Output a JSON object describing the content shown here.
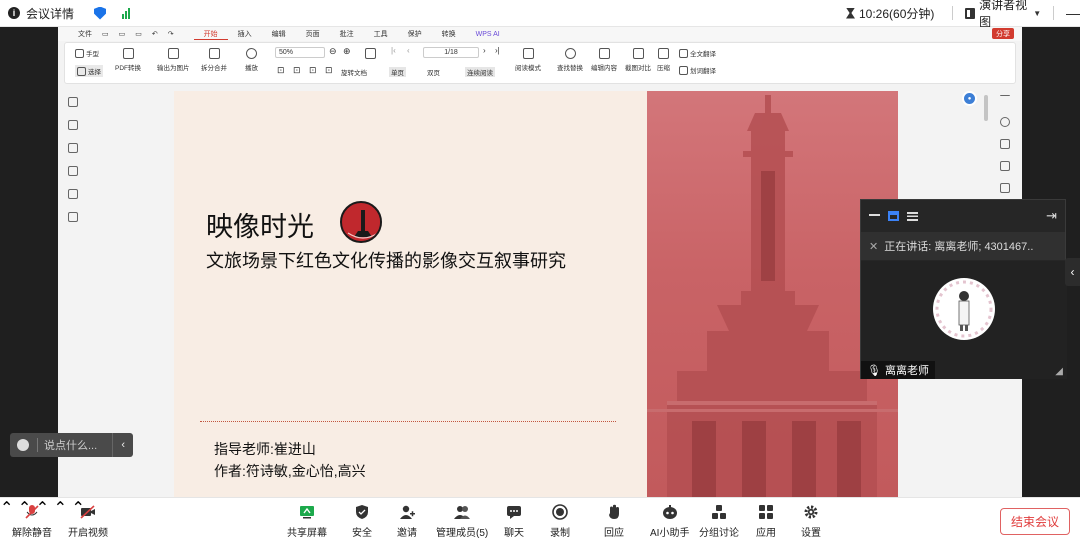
{
  "topbar": {
    "meeting_details": "会议详情",
    "timer": "10:26(60分钟)",
    "view_mode": "演讲者视图"
  },
  "wps": {
    "menu": [
      "文件",
      "开始",
      "插入",
      "编辑",
      "页面",
      "批注",
      "工具",
      "保护",
      "转换",
      "WPS AI"
    ],
    "share": "分享",
    "tools": {
      "hand": "手型",
      "select": "选择",
      "pdf_convert": "PDF转换",
      "export_image": "输出为图片",
      "split_merge": "拆分合并",
      "play": "播放",
      "zoom": "50%",
      "page": "1/18",
      "rotate": "旋转文档",
      "single": "单页",
      "double": "双页",
      "continuous": "连续阅读",
      "read_mode": "阅读模式",
      "find_replace": "查找替换",
      "edit_content": "编辑内容",
      "compare": "截图对比",
      "compress": "压缩",
      "full_translate": "全文翻译",
      "word_translate": "划词翻译"
    }
  },
  "slide": {
    "title": "映像时光",
    "subtitle": "文旅场景下红色文化传播的影像交互叙事研究",
    "advisor": "指导老师:崔进山",
    "authors": "作者:符诗敏,金心怡,高兴"
  },
  "speaker_panel": {
    "talking": "正在讲话:   离离老师; 4301467..",
    "name": "离离老师"
  },
  "chat": {
    "placeholder": "说点什么..."
  },
  "bottombar": {
    "mute": "解除静音",
    "video": "开启视频",
    "share": "共享屏幕",
    "security": "安全",
    "invite": "邀请",
    "members": "管理成员(5)",
    "chat": "聊天",
    "record": "录制",
    "reaction": "回应",
    "ai": "AI小助手",
    "breakout": "分组讨论",
    "apps": "应用",
    "settings": "设置",
    "end": "结束会议"
  }
}
